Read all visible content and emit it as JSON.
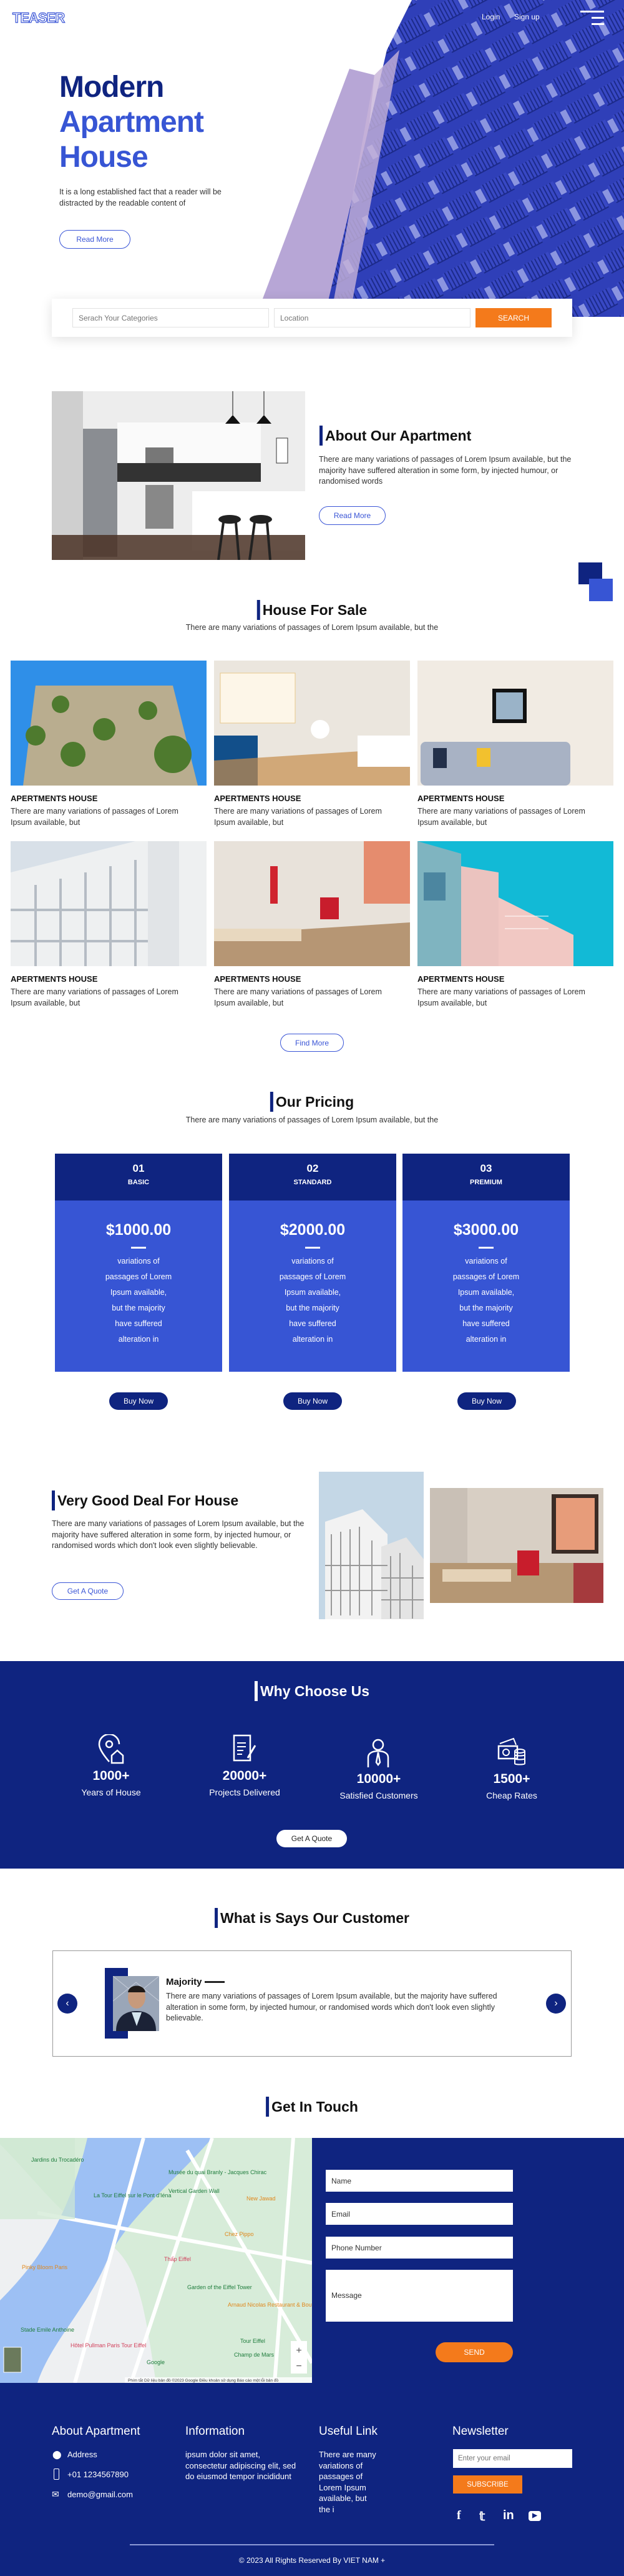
{
  "colors": {
    "navy": "#0f2480",
    "royal": "#3755d4",
    "orange": "#f47a1b"
  },
  "header": {
    "logo": "TEASER",
    "login": "Login",
    "signup": "Sign up",
    "menu_icon": "hamburger-icon"
  },
  "hero": {
    "title_line1": "Modern",
    "title_line2": "Apartment",
    "title_line3": "House",
    "text": "It is a long established fact that a reader will be distracted by the readable content of",
    "read_more": "Read More"
  },
  "search": {
    "categories_placeholder": "Serach Your Categories",
    "location_placeholder": "Location",
    "button": "SEARCH"
  },
  "about": {
    "title": "About Our Apartment",
    "text": "There are many variations of passages of Lorem Ipsum available, but the majority have suffered alteration in some form, by injected humour, or randomised words",
    "read_more": "Read More"
  },
  "sale": {
    "title": "House For Sale",
    "subtitle": "There are many variations of passages of Lorem Ipsum available, but the",
    "find_more": "Find More",
    "cards": [
      {
        "title": "APERTMENTS HOUSE",
        "text": "There are many variations of passages of Lorem Ipsum available, but"
      },
      {
        "title": "APERTMENTS HOUSE",
        "text": "There are many variations of passages of Lorem Ipsum available, but"
      },
      {
        "title": "APERTMENTS HOUSE",
        "text": "There are many variations of passages of Lorem Ipsum available, but"
      },
      {
        "title": "APERTMENTS HOUSE",
        "text": "There are many variations of passages of Lorem Ipsum available, but"
      },
      {
        "title": "APERTMENTS HOUSE",
        "text": "There are many variations of passages of Lorem Ipsum available, but"
      },
      {
        "title": "APERTMENTS HOUSE",
        "text": "There are many variations of passages of Lorem Ipsum available, but"
      }
    ]
  },
  "pricing": {
    "title": "Our Pricing",
    "subtitle": "There are many variations of passages of Lorem Ipsum available, but the",
    "plans": [
      {
        "num": "01",
        "name": "BASIC",
        "price": "$1000.00",
        "lines": [
          "variations of",
          "passages of Lorem",
          "Ipsum available,",
          "but the majority",
          "have suffered",
          "alteration in"
        ],
        "button": "Buy Now"
      },
      {
        "num": "02",
        "name": "STANDARD",
        "price": "$2000.00",
        "lines": [
          "variations of",
          "passages of Lorem",
          "Ipsum available,",
          "but the majority",
          "have suffered",
          "alteration in"
        ],
        "button": "Buy Now"
      },
      {
        "num": "03",
        "name": "PREMIUM",
        "price": "$3000.00",
        "lines": [
          "variations of",
          "passages of Lorem",
          "Ipsum available,",
          "but the majority",
          "have suffered",
          "alteration in"
        ],
        "button": "Buy Now"
      }
    ]
  },
  "deal": {
    "title": "Very Good Deal For House",
    "text": "There are many variations of passages of Lorem Ipsum available, but the majority have suffered alteration in some form, by injected humour, or randomised words which don't look even slightly believable.",
    "button": "Get A Quote"
  },
  "why": {
    "title": "Why Choose Us",
    "button": "Get A Quote",
    "stats": [
      {
        "icon": "location-house-icon",
        "value": "1000+",
        "label": "Years of House"
      },
      {
        "icon": "document-pen-icon",
        "value": "20000+",
        "label": "Projects Delivered"
      },
      {
        "icon": "businessman-icon",
        "value": "10000+",
        "label": "Satisfied Customers"
      },
      {
        "icon": "money-coins-icon",
        "value": "1500+",
        "label": "Cheap Rates"
      }
    ]
  },
  "testimonial": {
    "title": "What is Says Our Customer",
    "name": "Majority",
    "text": "There are many variations of passages of Lorem Ipsum available, but the majority have suffered alteration in some form, by injected humour, or randomised words which don't look even slightly believable."
  },
  "contact": {
    "title": "Get In Touch",
    "name_placeholder": "Name",
    "email_placeholder": "Email",
    "phone_placeholder": "Phone Number",
    "message_placeholder": "Message",
    "send": "SEND",
    "map_labels": [
      "Jardins du Trocadéro",
      "La Tour Eiffel sur le Pont d'Iéna",
      "Musée du quai Branly - Jacques Chirac",
      "Vertical Garden Wall",
      "New Jawad",
      "Chez Pippo",
      "Thấp Eiffel",
      "Pinky Bloom Paris",
      "Garden of the Eiffel Tower",
      "Arnaud Nicolas Restaurant & Boutique",
      "Stade Emile Anthoine",
      "Hôtel Pullman Paris Tour Eiffel",
      "Tour Eiffel",
      "Champ de Mars",
      "Google"
    ],
    "map_footer": "Phím tắt   Dữ liệu bản đồ ©2023 Google   Điều khoản sử dụng   Báo cáo một lỗi bản đồ"
  },
  "footer": {
    "about": {
      "title": "About Apartment",
      "address": "Address",
      "phone": "+01 1234567890",
      "email": "demo@gmail.com"
    },
    "information": {
      "title": "Information",
      "text": "ipsum dolor sit amet, consectetur adipiscing elit, sed do eiusmod tempor incididunt"
    },
    "useful": {
      "title": "Useful Link",
      "text": "There are many variations of passages of Lorem Ipsum available, but the i"
    },
    "newsletter": {
      "title": "Newsletter",
      "placeholder": "Enter your email",
      "button": "SUBSCRIBE"
    },
    "social": [
      "facebook-icon",
      "twitter-icon",
      "linkedin-icon",
      "youtube-icon"
    ],
    "copyright": "© 2023 All Rights Reserved By VIET NAM +"
  }
}
